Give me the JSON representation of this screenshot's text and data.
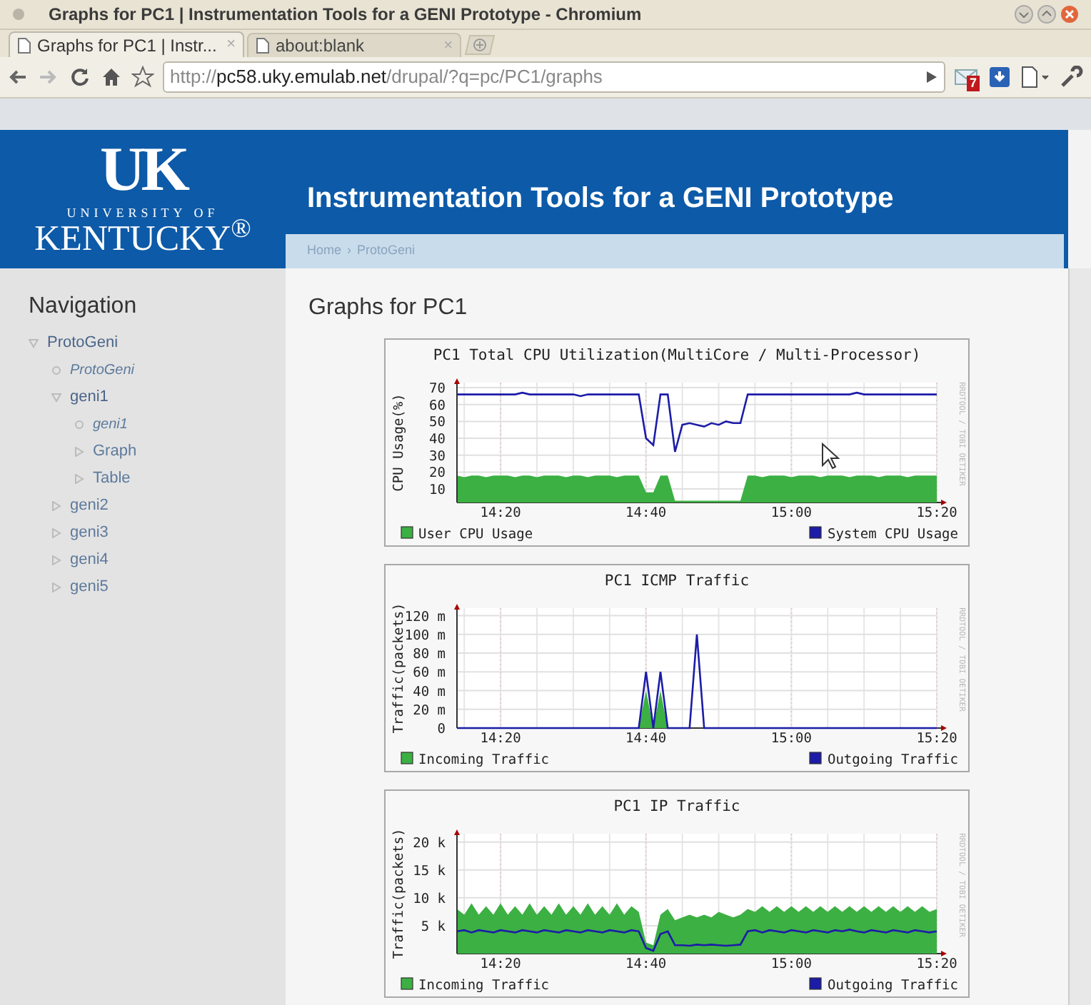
{
  "window": {
    "title": "Graphs for PC1 | Instrumentation Tools for a GENI Prototype - Chromium"
  },
  "tabs": [
    {
      "label": "Graphs for PC1 | Instr...",
      "close": "×",
      "selected": true
    },
    {
      "label": "about:blank",
      "close": "×",
      "selected": false
    }
  ],
  "address_bar": {
    "scheme": "http://",
    "host": "pc58.uky.emulab.net",
    "path": "/drupal/?q=pc/PC1/graphs"
  },
  "toolbar": {
    "mail_badge": "7"
  },
  "header": {
    "logo_mark": "UK",
    "logo_line1": "UNIVERSITY OF",
    "logo_line2": "KENTUCKY$^{®}$",
    "site_title": "Instrumentation Tools for a GENI Prototype",
    "breadcrumb": [
      "Home",
      "ProtoGeni"
    ],
    "breadcrumb_separator": "›"
  },
  "sidebar": {
    "title": "Navigation",
    "items": [
      {
        "label": "ProtoGeni",
        "kind": "branch",
        "expanded": true,
        "active": false,
        "children": [
          {
            "label": "ProtoGeni",
            "kind": "leaf",
            "active": true
          },
          {
            "label": "geni1",
            "kind": "branch",
            "expanded": true,
            "active": false,
            "children": [
              {
                "label": "geni1",
                "kind": "leaf",
                "active": true
              },
              {
                "label": "Graph",
                "kind": "branch",
                "expanded": false,
                "active": false
              },
              {
                "label": "Table",
                "kind": "branch",
                "expanded": false,
                "active": false
              }
            ]
          },
          {
            "label": "geni2",
            "kind": "branch",
            "expanded": false,
            "active": false
          },
          {
            "label": "geni3",
            "kind": "branch",
            "expanded": false,
            "active": false
          },
          {
            "label": "geni4",
            "kind": "branch",
            "expanded": false,
            "active": false
          },
          {
            "label": "geni5",
            "kind": "branch",
            "expanded": false,
            "active": false
          }
        ]
      }
    ]
  },
  "content": {
    "title": "Graphs for PC1",
    "charts": [
      {
        "credit": "RRDTOOL / TOBI OETIKER",
        "chart_data": {
          "type": "area",
          "title": "PC1 Total CPU Utilization(MultiCore / Multi-Processor)",
          "ylabel": "CPU Usage(%)",
          "ylim": [
            2,
            73
          ],
          "grid": true,
          "legend": true,
          "yticks": [
            10,
            20,
            30,
            40,
            50,
            60,
            70
          ],
          "categories": [
            null,
            null,
            null,
            null,
            null,
            null,
            "14:20",
            null,
            null,
            null,
            null,
            null,
            null,
            null,
            null,
            null,
            null,
            null,
            null,
            null,
            null,
            null,
            null,
            null,
            null,
            null,
            "14:40",
            null,
            null,
            null,
            null,
            null,
            null,
            null,
            null,
            null,
            null,
            null,
            null,
            null,
            null,
            null,
            null,
            null,
            null,
            null,
            "15:00",
            null,
            null,
            null,
            null,
            null,
            null,
            null,
            null,
            null,
            null,
            null,
            null,
            null,
            null,
            null,
            null,
            null,
            null,
            null,
            "15:20"
          ],
          "series": [
            {
              "name": "User CPU Usage",
              "color": "#3cb043",
              "type": "area",
              "values": [
                18,
                17,
                18,
                18,
                17,
                18,
                18,
                18,
                17,
                18,
                18,
                17,
                18,
                18,
                18,
                17,
                18,
                18,
                17,
                18,
                18,
                18,
                17,
                18,
                18,
                18,
                8,
                8,
                18,
                18,
                3,
                3,
                3,
                3,
                3,
                3,
                3,
                3,
                3,
                3,
                18,
                18,
                17,
                18,
                18,
                18,
                17,
                18,
                18,
                18,
                17,
                18,
                18,
                18,
                17,
                18,
                18,
                18,
                17,
                18,
                18,
                18,
                17,
                18,
                18,
                18,
                18
              ]
            },
            {
              "name": "System CPU Usage",
              "color": "#1c1ca8",
              "type": "line",
              "values": [
                66,
                66,
                66,
                66,
                66,
                66,
                66,
                66,
                66,
                67,
                66,
                66,
                66,
                66,
                66,
                66,
                66,
                65,
                66,
                66,
                66,
                66,
                66,
                66,
                66,
                66,
                40,
                36,
                66,
                66,
                32,
                48,
                49,
                48,
                47,
                49,
                48,
                50,
                49,
                49,
                66,
                66,
                66,
                66,
                66,
                66,
                66,
                66,
                66,
                66,
                66,
                66,
                66,
                66,
                66,
                67,
                66,
                66,
                66,
                66,
                66,
                66,
                66,
                66,
                66,
                66,
                66
              ]
            }
          ]
        }
      },
      {
        "credit": "RRDTOOL / TOBI OETIKER",
        "chart_data": {
          "type": "area",
          "title": "PC1 ICMP Traffic",
          "ylabel": "Traffic(packets)",
          "ylim": [
            0,
            128
          ],
          "grid": true,
          "legend": true,
          "yticks": [
            {
              "value": 0,
              "label": "0"
            },
            {
              "value": 20,
              "label": "20 m"
            },
            {
              "value": 40,
              "label": "40 m"
            },
            {
              "value": 60,
              "label": "60 m"
            },
            {
              "value": 80,
              "label": "80 m"
            },
            {
              "value": 100,
              "label": "100 m"
            },
            {
              "value": 120,
              "label": "120 m"
            }
          ],
          "categories": [
            null,
            null,
            null,
            null,
            null,
            null,
            "14:20",
            null,
            null,
            null,
            null,
            null,
            null,
            null,
            null,
            null,
            null,
            null,
            null,
            null,
            null,
            null,
            null,
            null,
            null,
            null,
            "14:40",
            null,
            null,
            null,
            null,
            null,
            null,
            null,
            null,
            null,
            null,
            null,
            null,
            null,
            null,
            null,
            null,
            null,
            null,
            null,
            "15:00",
            null,
            null,
            null,
            null,
            null,
            null,
            null,
            null,
            null,
            null,
            null,
            null,
            null,
            null,
            null,
            null,
            null,
            null,
            null,
            "15:20"
          ],
          "series": [
            {
              "name": "Incoming Traffic",
              "color": "#3cb043",
              "type": "area",
              "values": [
                0,
                0,
                0,
                0,
                0,
                0,
                0,
                0,
                0,
                0,
                0,
                0,
                0,
                0,
                0,
                0,
                0,
                0,
                0,
                0,
                0,
                0,
                0,
                0,
                0,
                0,
                40,
                0,
                40,
                0,
                0,
                0,
                0,
                0,
                0,
                0,
                0,
                0,
                0,
                0,
                0,
                0,
                0,
                0,
                0,
                0,
                0,
                0,
                0,
                0,
                0,
                0,
                0,
                0,
                0,
                0,
                0,
                0,
                0,
                0,
                0,
                0,
                0,
                0,
                0,
                0,
                0
              ]
            },
            {
              "name": "Outgoing Traffic",
              "color": "#1c1ca8",
              "type": "line",
              "values": [
                0,
                0,
                0,
                0,
                0,
                0,
                0,
                0,
                0,
                0,
                0,
                0,
                0,
                0,
                0,
                0,
                0,
                0,
                0,
                0,
                0,
                0,
                0,
                0,
                0,
                0,
                60,
                0,
                60,
                0,
                0,
                0,
                0,
                100,
                0,
                0,
                0,
                0,
                0,
                0,
                0,
                0,
                0,
                0,
                0,
                0,
                0,
                0,
                0,
                0,
                0,
                0,
                0,
                0,
                0,
                0,
                0,
                0,
                0,
                0,
                0,
                0,
                0,
                0,
                0,
                0,
                0
              ]
            }
          ]
        }
      },
      {
        "credit": "RRDTOOL / TOBI OETIKER",
        "chart_data": {
          "type": "area",
          "title": "PC1 IP Traffic",
          "ylabel": "Traffic(packets)",
          "ylim": [
            0,
            21.5
          ],
          "grid": true,
          "legend": true,
          "yticks": [
            {
              "value": 5,
              "label": "5 k"
            },
            {
              "value": 10,
              "label": "10 k"
            },
            {
              "value": 15,
              "label": "15 k"
            },
            {
              "value": 20,
              "label": "20 k"
            }
          ],
          "categories": [
            null,
            null,
            null,
            null,
            null,
            null,
            "14:20",
            null,
            null,
            null,
            null,
            null,
            null,
            null,
            null,
            null,
            null,
            null,
            null,
            null,
            null,
            null,
            null,
            null,
            null,
            null,
            "14:40",
            null,
            null,
            null,
            null,
            null,
            null,
            null,
            null,
            null,
            null,
            null,
            null,
            null,
            null,
            null,
            null,
            null,
            null,
            null,
            "15:00",
            null,
            null,
            null,
            null,
            null,
            null,
            null,
            null,
            null,
            null,
            null,
            null,
            null,
            null,
            null,
            null,
            null,
            null,
            null,
            "15:20"
          ],
          "series": [
            {
              "name": "Incoming Traffic",
              "color": "#3cb043",
              "type": "area",
              "values": [
                8,
                7,
                9,
                7,
                8.5,
                7,
                9,
                7,
                8.5,
                7,
                9,
                7,
                8.5,
                7,
                9,
                7,
                8.5,
                7,
                9,
                7,
                8.5,
                7,
                9,
                7,
                8.5,
                7.5,
                2,
                1.5,
                7,
                8,
                6,
                6.5,
                7,
                6.5,
                7,
                6.5,
                7.5,
                7,
                6.5,
                7,
                8,
                7.5,
                8.5,
                7.5,
                8.5,
                7.5,
                8.5,
                7.5,
                8.5,
                7.5,
                8.5,
                7.5,
                8.5,
                7.5,
                8.5,
                7.5,
                8.5,
                7.5,
                8.5,
                7.5,
                8.5,
                7.5,
                8.5,
                7.5,
                8.5,
                7.5,
                8
              ]
            },
            {
              "name": "Outgoing Traffic",
              "color": "#1c1ca8",
              "type": "line",
              "values": [
                4,
                4.2,
                3.8,
                4.2,
                4,
                3.8,
                4.2,
                4,
                3.8,
                4.2,
                4,
                3.8,
                4.2,
                4,
                3.8,
                4.2,
                4,
                3.8,
                4.2,
                4,
                3.8,
                4.2,
                4,
                3.8,
                4.2,
                4,
                1,
                0.5,
                3.5,
                4,
                1.5,
                1.5,
                1.4,
                1.6,
                1.5,
                1.6,
                1.5,
                1.4,
                1.5,
                1.6,
                4,
                4.2,
                3.8,
                4.2,
                4,
                3.8,
                4.2,
                4,
                3.8,
                4.2,
                4,
                3.8,
                4.2,
                4,
                4.3,
                4,
                3.8,
                4.2,
                4,
                3.8,
                4.2,
                4,
                3.8,
                4.2,
                4,
                3.8,
                4
              ]
            }
          ]
        }
      }
    ]
  }
}
